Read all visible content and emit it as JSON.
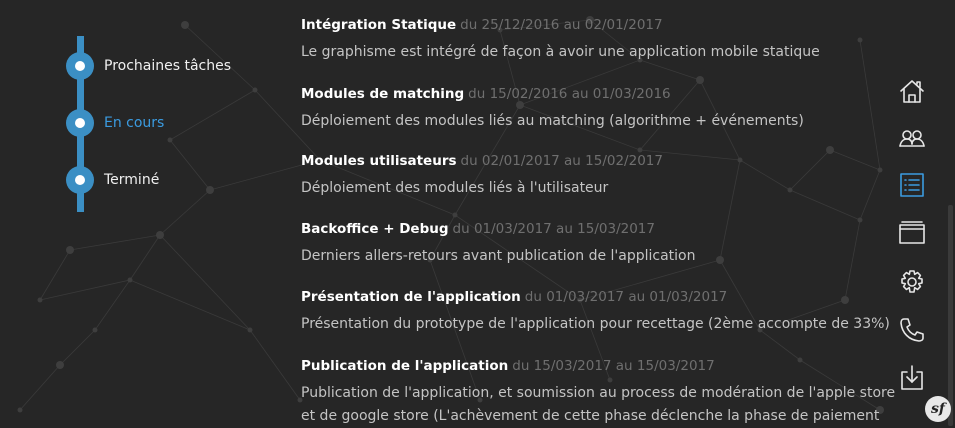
{
  "timeline": {
    "items": [
      {
        "label": "Prochaines tâches"
      },
      {
        "label": "En cours"
      },
      {
        "label": "Terminé"
      }
    ],
    "active_index": 1
  },
  "tasks": [
    {
      "title": "Intégration Statique",
      "dates": "du 25/12/2016 au 02/01/2017",
      "description": "Le graphisme est intégré de façon à avoir une application mobile statique"
    },
    {
      "title": "Modules de matching",
      "dates": "du 15/02/2016 au 01/03/2016",
      "description": "Déploiement des modules liés au matching (algorithme + événements)"
    },
    {
      "title": "Modules utilisateurs",
      "dates": "du 02/01/2017 au 15/02/2017",
      "description": "Déploiement des modules liés à l'utilisateur"
    },
    {
      "title": "Backoffice + Debug",
      "dates": "du 01/03/2017 au 15/03/2017",
      "description": "Derniers allers-retours avant publication de l'application"
    },
    {
      "title": "Présentation de l'application",
      "dates": "du 01/03/2017 au 01/03/2017",
      "description": "Présentation du prototype de l'application pour recettage (2ème accompte de 33%)"
    },
    {
      "title": "Publication de l'application",
      "dates": "du 15/03/2017 au 15/03/2017",
      "description": "Publication de l'application, et soumission au process de modération de l'apple store et de google store (L'achèvement de cette phase déclenche la phase de paiement"
    }
  ],
  "side_menu": {
    "icons": [
      "home-icon",
      "team-icon",
      "list-icon",
      "window-icon",
      "gear-icon",
      "phone-icon",
      "download-icon"
    ],
    "active_icon": "list-icon"
  },
  "badge": {
    "label": "sf"
  },
  "colors": {
    "background": "#262626",
    "accent": "#3b8fc4",
    "active_text": "#3b9be0",
    "date_text": "#6f6f6f"
  }
}
